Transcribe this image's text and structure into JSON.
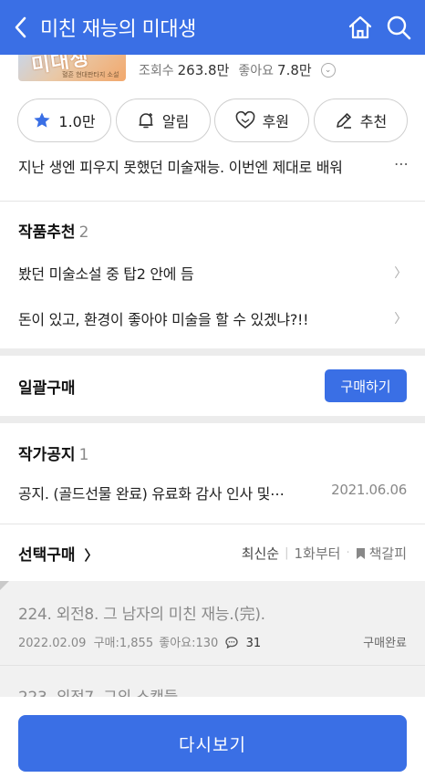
{
  "header": {
    "title": "미친 재능의 미대생"
  },
  "book": {
    "cover_text": "미대생",
    "cover_sub": "혈흔 현대판타지 소설",
    "views_label": "조회수",
    "views_value": "263.8만",
    "likes_label": "좋아요",
    "likes_value": "7.8만"
  },
  "actions": {
    "star_label": "1.0만",
    "alarm_label": "알림",
    "support_label": "후원",
    "recommend_label": "추천"
  },
  "description": "지난 생엔 피우지 못했던 미술재능. 이번엔 제대로 배워",
  "description_more": "⋯",
  "recommend_section": {
    "title": "작품추천",
    "count": "2",
    "items": [
      "봤던 미술소설 중 탑2 안에 듬",
      "돈이 있고, 환경이 좋아야 미술을 할 수 있겠냐?!!"
    ]
  },
  "bulk_buy": {
    "title": "일괄구매",
    "button": "구매하기"
  },
  "notice_section": {
    "title": "작가공지",
    "count": "1",
    "text": "공지. (골드선물 완료) 유료화 감사 인사 및⋯",
    "date": "2021.06.06"
  },
  "select_buy": {
    "title": "선택구매",
    "sort_latest": "최신순",
    "sort_first": "1화부터",
    "bookmark": "책갈피"
  },
  "episodes": [
    {
      "title": "224. 외전8. 그 남자의 미친 재능.(完).",
      "date": "2022.02.09",
      "purchases": "구매:1,855",
      "likes": "좋아요:130",
      "comments": "31",
      "status": "구매완료"
    },
    {
      "title": "223. 외전7. 그의 스캔들"
    }
  ],
  "bottom": {
    "reread_label": "다시보기"
  }
}
